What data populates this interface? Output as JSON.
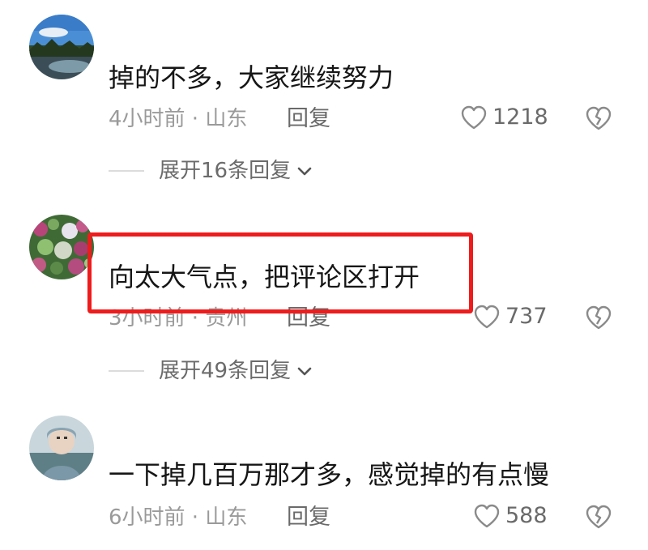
{
  "comments": [
    {
      "text": "掉的不多，大家继续努力",
      "meta": "4小时前 · 山东",
      "reply_label": "回复",
      "likes": "1218",
      "expand_label": "展开16条回复"
    },
    {
      "text": "向太大气点，把评论区打开",
      "meta": "3小时前 · 贵州",
      "reply_label": "回复",
      "likes": "737",
      "expand_label": "展开49条回复"
    },
    {
      "text": "一下掉几百万那才多，感觉掉的有点慢",
      "meta": "6小时前 · 山东",
      "reply_label": "回复",
      "likes": "588"
    }
  ],
  "icons": {
    "like": "heart-outline-icon",
    "dislike": "broken-heart-icon",
    "expand": "chevron-down-icon"
  },
  "colors": {
    "highlight_border": "#ee1c1c",
    "meta_text": "#9a9a9a"
  }
}
